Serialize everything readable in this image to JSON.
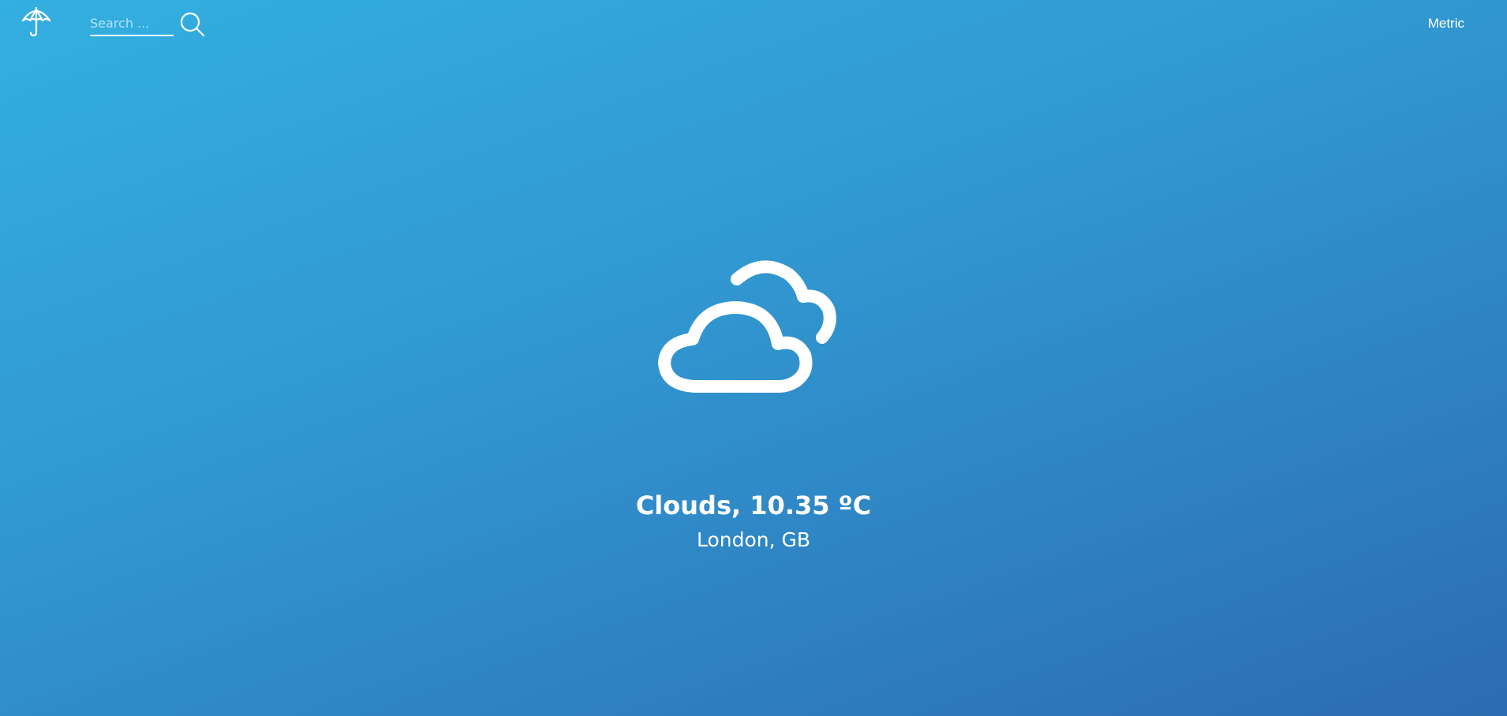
{
  "header": {
    "logo_icon": "umbrella-icon",
    "search": {
      "placeholder": "Search ...",
      "value": "",
      "icon": "search-icon"
    },
    "units_label": "Metric"
  },
  "weather": {
    "icon": "clouds-icon",
    "condition": "Clouds",
    "temperature": "10.35 ºC",
    "summary": "Clouds, 10.35 ºC",
    "location": "London, GB"
  },
  "colors": {
    "gradient_start": "#33afe0",
    "gradient_end": "#2c6cb0",
    "foreground": "#ffffff"
  }
}
